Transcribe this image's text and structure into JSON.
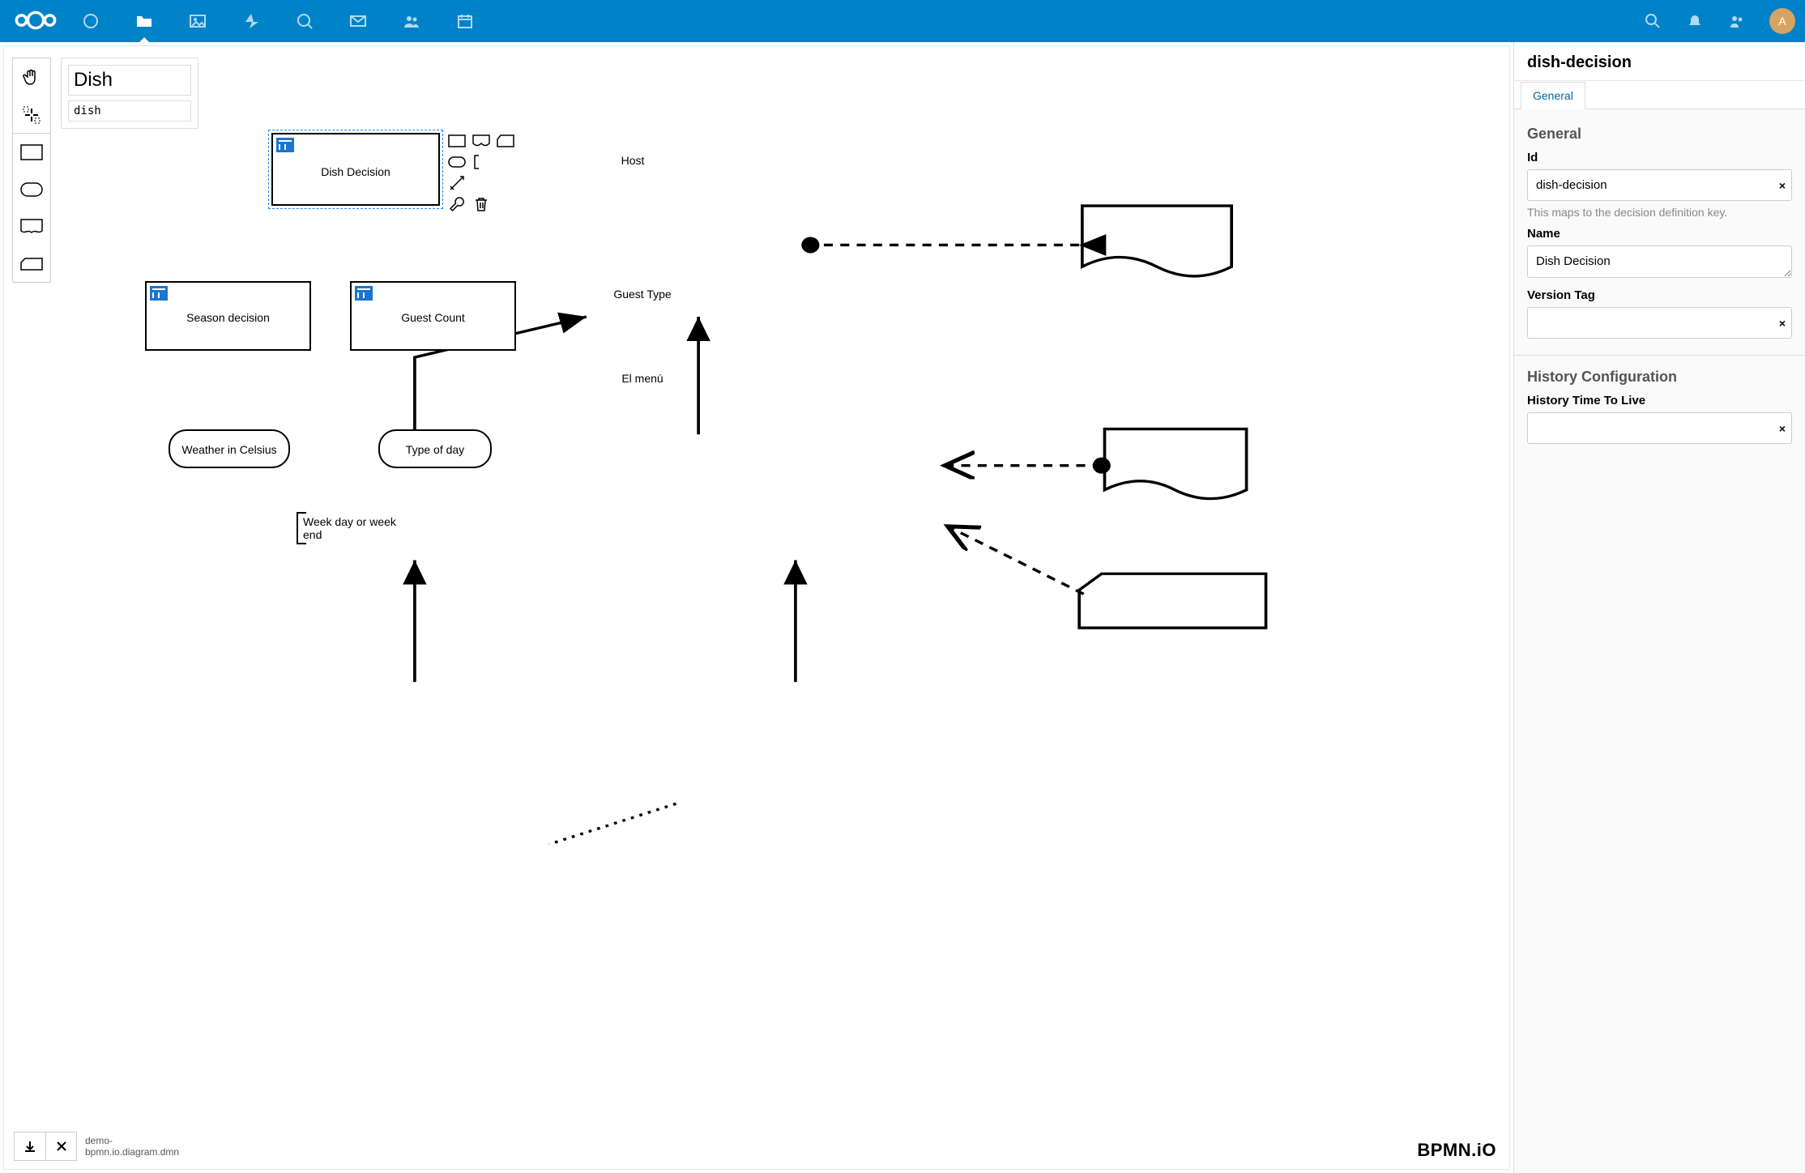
{
  "topbar": {
    "avatar_initial": "A"
  },
  "name_panel": {
    "title": "Dish",
    "id": "dish"
  },
  "diagram": {
    "dish_decision": "Dish Decision",
    "season_decision": "Season decision",
    "guest_count": "Guest Count",
    "weather": "Weather in Celsius",
    "type_of_day": "Type of day",
    "host": "Host",
    "guest_type": "Guest Type",
    "el_menu": "El menú",
    "annotation": "Week day or week end"
  },
  "footer": {
    "filename_line1": "demo-",
    "filename_line2": "bpmn.io.diagram.dmn",
    "brand": "BPMN.iO"
  },
  "props": {
    "header": "dish-decision",
    "tab_general": "General",
    "section_general": "General",
    "id_label": "Id",
    "id_value": "dish-decision",
    "id_helper": "This maps to the decision definition key.",
    "name_label": "Name",
    "name_value": "Dish Decision",
    "version_tag_label": "Version Tag",
    "version_tag_value": "",
    "history_section": "History Configuration",
    "ttl_label": "History Time To Live",
    "ttl_value": ""
  }
}
